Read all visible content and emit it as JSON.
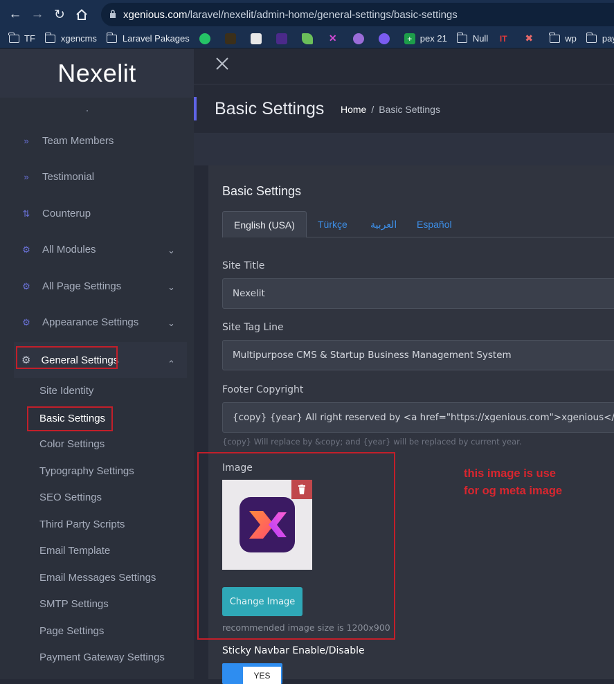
{
  "browser": {
    "url_domain": "xgenious.com",
    "url_path": "/laravel/nexelit/admin-home/general-settings/basic-settings",
    "bookmarks": [
      {
        "label": "TF",
        "icon": "folder-icon"
      },
      {
        "label": "xgencms",
        "icon": "folder-icon"
      },
      {
        "label": "Laravel Pakages",
        "icon": "folder-icon"
      },
      {
        "label": "",
        "icon": "whatsapp-icon"
      },
      {
        "label": "",
        "icon": "bookmark-icon"
      },
      {
        "label": "",
        "icon": "bookmark-icon"
      },
      {
        "label": "",
        "icon": "bookmark-icon"
      },
      {
        "label": "",
        "icon": "bookmark-icon"
      },
      {
        "label": "",
        "icon": "xgenious-icon"
      },
      {
        "label": "",
        "icon": "bookmark-icon"
      },
      {
        "label": "",
        "icon": "messenger-icon"
      },
      {
        "label": "pex 21",
        "icon": "plus-icon"
      },
      {
        "label": "Null",
        "icon": "folder-icon"
      },
      {
        "label": "",
        "icon": "it-icon"
      },
      {
        "label": "",
        "icon": "bookmark-icon"
      },
      {
        "label": "wp",
        "icon": "folder-icon"
      },
      {
        "label": "payment g",
        "icon": "folder-icon"
      }
    ]
  },
  "sidebar": {
    "brand": "Nexelit",
    "items": [
      {
        "label": "Team Members",
        "icon": "chevrons-right-icon",
        "has_submenu": false
      },
      {
        "label": "Testimonial",
        "icon": "chevrons-right-icon",
        "has_submenu": false
      },
      {
        "label": "Counterup",
        "icon": "arrows-icon",
        "has_submenu": false
      },
      {
        "label": "All Modules",
        "icon": "gear-icon",
        "has_submenu": true
      },
      {
        "label": "All Page Settings",
        "icon": "gear-icon",
        "has_submenu": true
      },
      {
        "label": "Appearance Settings",
        "icon": "gear-icon",
        "has_submenu": true
      },
      {
        "label": "General Settings",
        "icon": "gear-icon",
        "has_submenu": true,
        "expanded": true
      }
    ],
    "submenu": [
      "Site Identity",
      "Basic Settings",
      "Color Settings",
      "Typography Settings",
      "SEO Settings",
      "Third Party Scripts",
      "Email Template",
      "Email Messages Settings",
      "SMTP Settings",
      "Page Settings",
      "Payment Gateway Settings"
    ],
    "active_submenu": "Basic Settings"
  },
  "header": {
    "title": "Basic Settings",
    "breadcrumb_home": "Home",
    "breadcrumb_sep": "/",
    "breadcrumb_current": "Basic Settings"
  },
  "card": {
    "title": "Basic Settings",
    "tabs": [
      "English (USA)",
      "Türkçe",
      "العربية",
      "Español"
    ],
    "active_tab": "English (USA)",
    "fields": {
      "site_title_label": "Site Title",
      "site_title_value": "Nexelit",
      "tagline_label": "Site Tag Line",
      "tagline_value": "Multipurpose CMS & Startup Business Management System",
      "footer_label": "Footer Copyright",
      "footer_value": "{copy}  {year}  All right reserved by  <a href=\"https://xgenious.com\">xgenious</a>",
      "footer_help": "{copy} Will replace by &copy; and {year} will be replaced by current year."
    },
    "image": {
      "label": "Image",
      "change_button": "Change Image",
      "recommended": "recommended image size is 1200x900"
    },
    "annotation": [
      "this image is use",
      "for og meta image"
    ],
    "sticky_label": "Sticky Navbar Enable/Disable",
    "sticky_toggle": "YES"
  },
  "colors": {
    "accent": "#5f64e6",
    "link": "#3d8ee6",
    "annotation_red": "#d8262f",
    "button_teal": "#2fa8b7",
    "toggle_blue": "#2e8df0"
  }
}
